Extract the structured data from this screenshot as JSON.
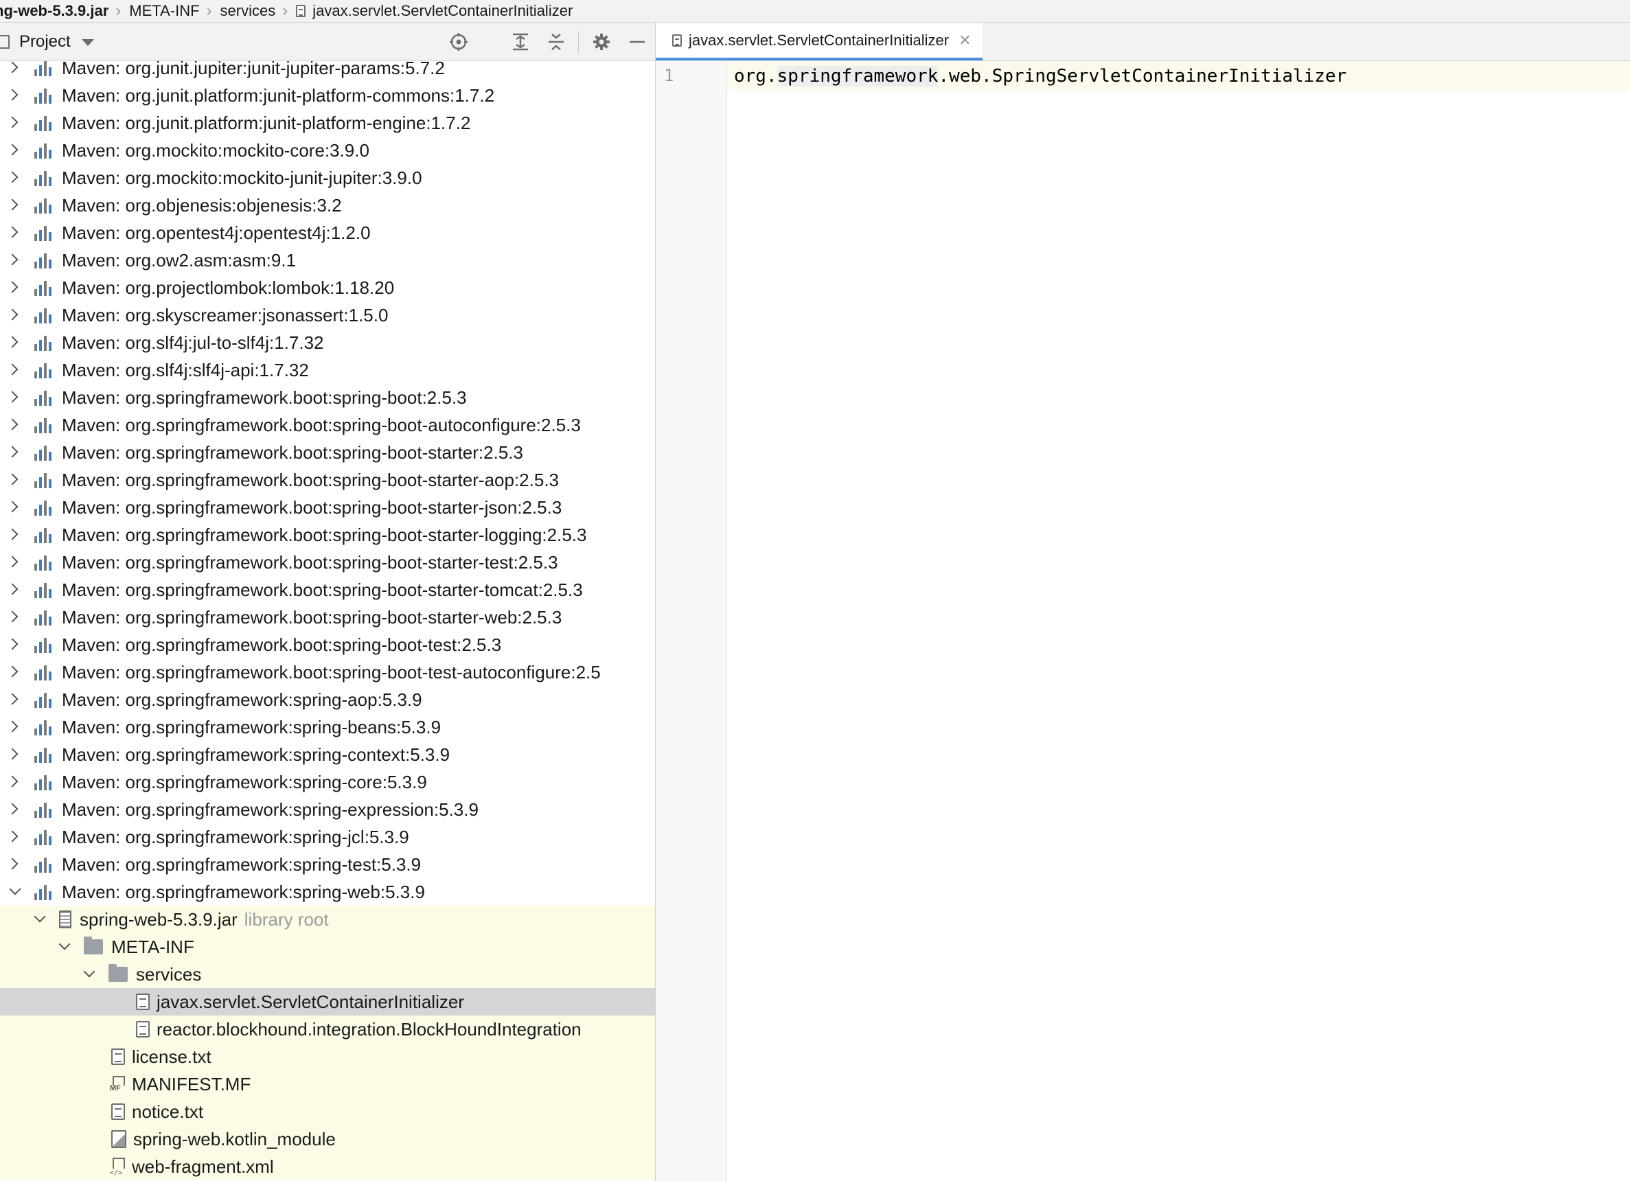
{
  "breadcrumb": {
    "items": [
      "ng-web-5.3.9.jar",
      "META-INF",
      "services",
      "javax.servlet.ServletContainerInitializer"
    ]
  },
  "project_panel": {
    "title": "Project",
    "toolbar_icons": [
      "locate-icon",
      "expand-all-icon",
      "collapse-all-icon",
      "gear-icon",
      "minimize-icon"
    ]
  },
  "tree": {
    "libraries": [
      "Maven: org.junit.jupiter:junit-jupiter-params:5.7.2",
      "Maven: org.junit.platform:junit-platform-commons:1.7.2",
      "Maven: org.junit.platform:junit-platform-engine:1.7.2",
      "Maven: org.mockito:mockito-core:3.9.0",
      "Maven: org.mockito:mockito-junit-jupiter:3.9.0",
      "Maven: org.objenesis:objenesis:3.2",
      "Maven: org.opentest4j:opentest4j:1.2.0",
      "Maven: org.ow2.asm:asm:9.1",
      "Maven: org.projectlombok:lombok:1.18.20",
      "Maven: org.skyscreamer:jsonassert:1.5.0",
      "Maven: org.slf4j:jul-to-slf4j:1.7.32",
      "Maven: org.slf4j:slf4j-api:1.7.32",
      "Maven: org.springframework.boot:spring-boot:2.5.3",
      "Maven: org.springframework.boot:spring-boot-autoconfigure:2.5.3",
      "Maven: org.springframework.boot:spring-boot-starter:2.5.3",
      "Maven: org.springframework.boot:spring-boot-starter-aop:2.5.3",
      "Maven: org.springframework.boot:spring-boot-starter-json:2.5.3",
      "Maven: org.springframework.boot:spring-boot-starter-logging:2.5.3",
      "Maven: org.springframework.boot:spring-boot-starter-test:2.5.3",
      "Maven: org.springframework.boot:spring-boot-starter-tomcat:2.5.3",
      "Maven: org.springframework.boot:spring-boot-starter-web:2.5.3",
      "Maven: org.springframework.boot:spring-boot-test:2.5.3",
      "Maven: org.springframework.boot:spring-boot-test-autoconfigure:2.5",
      "Maven: org.springframework:spring-aop:5.3.9",
      "Maven: org.springframework:spring-beans:5.3.9",
      "Maven: org.springframework:spring-context:5.3.9",
      "Maven: org.springframework:spring-core:5.3.9",
      "Maven: org.springframework:spring-expression:5.3.9",
      "Maven: org.springframework:spring-jcl:5.3.9",
      "Maven: org.springframework:spring-test:5.3.9"
    ],
    "expanded_library": "Maven: org.springframework:spring-web:5.3.9",
    "jar": {
      "name": "spring-web-5.3.9.jar",
      "hint": "library root"
    },
    "meta_inf": "META-INF",
    "services": "services",
    "service_files": [
      "javax.servlet.ServletContainerInitializer",
      "reactor.blockhound.integration.BlockHoundIntegration"
    ],
    "files": [
      {
        "name": "license.txt",
        "icon": "text-file-icon"
      },
      {
        "name": "MANIFEST.MF",
        "icon": "manifest-file-icon",
        "badge": "MF"
      },
      {
        "name": "notice.txt",
        "icon": "text-file-icon"
      },
      {
        "name": "spring-web.kotlin_module",
        "icon": "kotlin-module-file-icon"
      },
      {
        "name": "web-fragment.xml",
        "icon": "xml-file-icon"
      }
    ]
  },
  "editor": {
    "tab_label": "javax.servlet.ServletContainerInitializer",
    "line_number": "1",
    "code_prefix": "org.",
    "code_highlight": "springframework",
    "code_suffix": ".web.SpringServletContainerInitializer"
  },
  "colors": {
    "library_root_bg": "#fcfbe6",
    "selection_bg": "#d5d5d5",
    "tab_underline": "#4a8fe0"
  }
}
